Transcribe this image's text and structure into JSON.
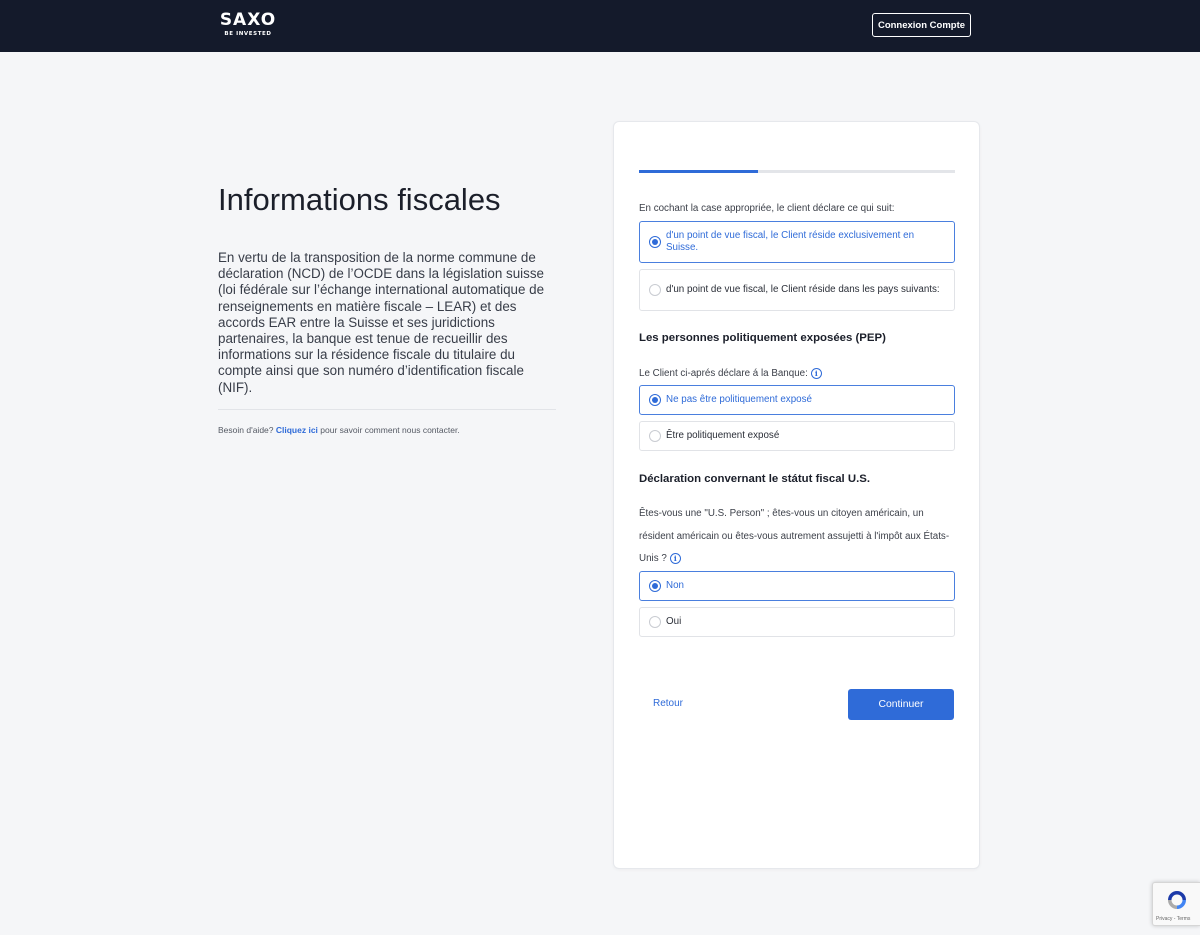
{
  "header": {
    "logo_main": "SAXO",
    "logo_sub": "BE INVESTED",
    "login_label": "Connexion Compte"
  },
  "left": {
    "title": "Informations fiscales",
    "intro": "En vertu de la transposition de la norme commune de déclaration (NCD) de l’OCDE dans la législation suisse (loi fédérale sur l’échange international automatique de renseignements en matière fiscale – LEAR) et des accords EAR entre la Suisse et ses juridictions partenaires, la banque est tenue de recueillir des informations sur la résidence fiscale du titulaire du compte ainsi que son numéro d’identification fiscale (NIF).",
    "help_prefix": "Besoin d'aide?",
    "help_link": "Cliquez ici",
    "help_suffix": "pour savoir comment nous contacter."
  },
  "form": {
    "progress": 0.375,
    "residence": {
      "label": "En cochant la case appropriée, le client déclare ce qui suit:",
      "options": [
        {
          "label": "d'un point de vue fiscal, le Client réside exclusivement en Suisse.",
          "selected": true
        },
        {
          "label": "d'un point de vue fiscal, le Client réside dans les pays suivants:",
          "selected": false
        }
      ]
    },
    "pep": {
      "title": "Les personnes politiquement exposées (PEP)",
      "label": "Le Client ci-aprés déclare á la Banque:",
      "info_icon": "info-icon",
      "options": [
        {
          "label": "Ne pas être politiquement exposé",
          "selected": true
        },
        {
          "label": "Être politiquement exposé",
          "selected": false
        }
      ]
    },
    "us": {
      "title": "Déclaration convernant le státut fiscal U.S.",
      "label": "Êtes-vous une \"U.S. Person\" ; êtes-vous un citoyen américain, un résident américain ou êtes-vous autrement assujetti à l'impôt aux États-Unis ?",
      "info_icon": "info-icon",
      "options": [
        {
          "label": "Non",
          "selected": true
        },
        {
          "label": "Oui",
          "selected": false
        }
      ]
    },
    "back_label": "Retour",
    "continue_label": "Continuer"
  },
  "recaptcha": {
    "text": "Privacy - Terms"
  },
  "colors": {
    "accent": "#2f6bd8",
    "header_bg": "#141a2b",
    "page_bg": "#f5f6f8"
  }
}
